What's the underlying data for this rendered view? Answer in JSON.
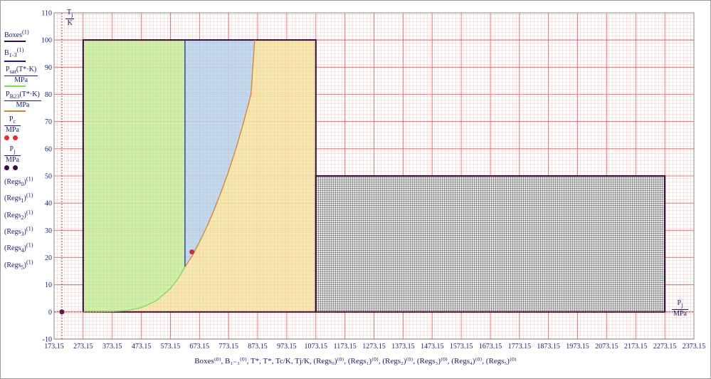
{
  "chart_data": {
    "type": "line",
    "xlim": [
      173.15,
      2373.15
    ],
    "ylim": [
      -10,
      110
    ],
    "x_ticks": [
      "173.15",
      "273.15",
      "373.15",
      "473.15",
      "573.15",
      "673.15",
      "773.15",
      "873.15",
      "973.15",
      "1073.15",
      "1173.15",
      "1273.15",
      "1373.15",
      "1473.15",
      "1573.15",
      "1673.15",
      "1773.15",
      "1873.15",
      "1973.15",
      "2073.15",
      "2173.15",
      "2273.15",
      "2373.15"
    ],
    "y_ticks": [
      "-10",
      "0",
      "10",
      "20",
      "30",
      "40",
      "50",
      "60",
      "70",
      "80",
      "90",
      "100",
      "110"
    ],
    "grid": true,
    "regions": [
      {
        "name": "(Regs0)",
        "fill": "#c8f0a0",
        "x0": 273.15,
        "x1": 623.15,
        "y0": 0,
        "y1": 100,
        "pattern": "grid"
      },
      {
        "name": "(Regs1)",
        "fill": "#b9d6ee",
        "x0": 623.15,
        "x1": 863.15,
        "y0": 16.5,
        "y1": 100,
        "pattern": "grid"
      },
      {
        "name": "(Regs2)",
        "fill": "#f4e7a6",
        "x0": 623.15,
        "x1": 1073.15,
        "y0": 0,
        "y1": 100,
        "pattern": "grid"
      },
      {
        "name": "(Regs5)",
        "fill": "#4a4a4a",
        "x0": 1073.15,
        "x1": 2273.15,
        "y0": 0,
        "y1": 50,
        "pattern": "dense"
      }
    ],
    "series": [
      {
        "name": "Boxes",
        "color": "#3a0a3a",
        "segments": [
          {
            "x": [
              273.15,
              1073.15,
              1073.15,
              273.15,
              273.15
            ],
            "y": [
              0,
              0,
              100,
              100,
              0
            ]
          },
          {
            "x": [
              1073.15,
              2273.15,
              2273.15,
              1073.15,
              1073.15
            ],
            "y": [
              0,
              0,
              50,
              50,
              0
            ]
          }
        ]
      },
      {
        "name": "B1-3",
        "color": "#1a1a99",
        "segments": [
          {
            "x": [
              623.15,
              623.15
            ],
            "y": [
              16.5,
              100
            ]
          }
        ]
      },
      {
        "name": "Psat(T*·K)/MPa",
        "color": "#7ed957",
        "x": [
          273.15,
          300,
          373.15,
          423.15,
          473.15,
          523.15,
          573.15,
          600,
          623.15
        ],
        "y": [
          0.0006,
          0.0035,
          0.1,
          0.48,
          1.55,
          4.0,
          8.6,
          12.3,
          16.5
        ]
      },
      {
        "name": "PB23(T*·K)/MPa",
        "color": "#d98030",
        "x": [
          623.15,
          650,
          673.15,
          700,
          723.15,
          750,
          773.15,
          800,
          823.15,
          850,
          863.15
        ],
        "y": [
          16.5,
          21.0,
          25.7,
          31.7,
          37.5,
          44.8,
          51.7,
          60.6,
          69.1,
          79.9,
          100
        ]
      }
    ],
    "points": [
      {
        "name": "Pc/MPa",
        "color": "#c0344a",
        "x": 647.1,
        "y": 22.06
      },
      {
        "name": "Pj/MPa",
        "color": "#5a0a4a",
        "x": 200,
        "y": 0
      }
    ]
  },
  "legend": [
    {
      "label": "Boxes",
      "sup": "(1)",
      "color": "#3a0a3a",
      "kind": "line"
    },
    {
      "label": "B",
      "sub": "1-3",
      "sup": "(1)",
      "color": "#1a1a99",
      "kind": "line"
    },
    {
      "label": "P",
      "sub": "sat",
      "tail": "(T*·K)",
      "den": "MPa",
      "color": "#7ed957",
      "kind": "line"
    },
    {
      "label": "P",
      "sub": "B23",
      "tail": "(T*·K)",
      "den": "MPa",
      "color": "#d98030",
      "kind": "line"
    },
    {
      "label": "P",
      "sub": "c",
      "den": "MPa",
      "color": "#d93030",
      "kind": "dots"
    },
    {
      "label": "P",
      "sub": "j",
      "den": "MPa",
      "color": "#3a0a4a",
      "kind": "dots"
    },
    {
      "label": "(Regs",
      "sub": "0",
      "tail": ")",
      "sup": "(1)",
      "kind": "text"
    },
    {
      "label": "(Regs",
      "sub": "1",
      "tail": ")",
      "sup": "(1)",
      "kind": "text"
    },
    {
      "label": "(Regs",
      "sub": "2",
      "tail": ")",
      "sup": "(1)",
      "kind": "text"
    },
    {
      "label": "(Regs",
      "sub": "3",
      "tail": ")",
      "sup": "(1)",
      "kind": "text"
    },
    {
      "label": "(Regs",
      "sub": "4",
      "tail": ")",
      "sup": "(1)",
      "kind": "text"
    },
    {
      "label": "(Regs",
      "sub": "5",
      "tail": ")",
      "sup": "(1)",
      "kind": "text"
    }
  ],
  "y_unit": {
    "num": "T",
    "num_sub": "j",
    "den": "K"
  },
  "x_unit": {
    "num": "P",
    "num_sub": "j",
    "den": "MPa"
  },
  "x_title": "Boxes⁽⁰⁾, B₁₋₃⁽⁰⁾, T*, T*, Tc/K, Tj/K, (Regs₀)⁽⁰⁾, (Regs₁)⁽⁰⁾, (Regs₂)⁽⁰⁾, (Regs₃)⁽⁰⁾, (Regs₄)⁽⁰⁾, (Regs₅)⁽⁰⁾"
}
